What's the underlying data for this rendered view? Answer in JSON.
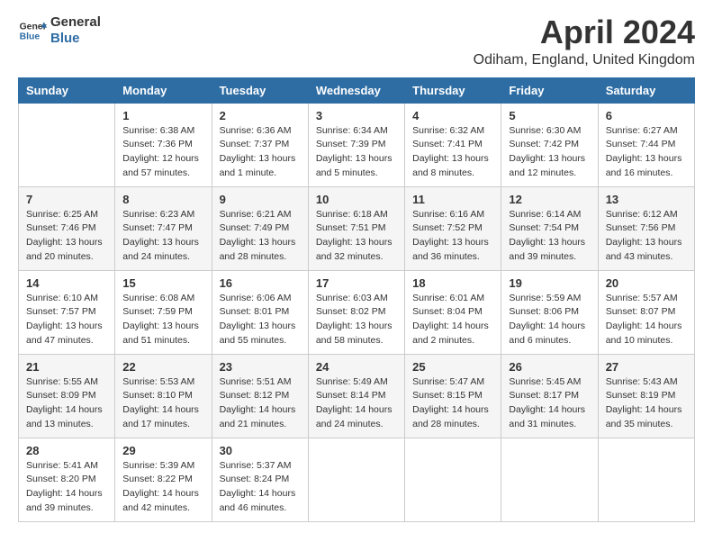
{
  "logo": {
    "general": "General",
    "blue": "Blue"
  },
  "title": "April 2024",
  "subtitle": "Odiham, England, United Kingdom",
  "days_header": [
    "Sunday",
    "Monday",
    "Tuesday",
    "Wednesday",
    "Thursday",
    "Friday",
    "Saturday"
  ],
  "weeks": [
    [
      {
        "num": "",
        "info": ""
      },
      {
        "num": "1",
        "info": "Sunrise: 6:38 AM\nSunset: 7:36 PM\nDaylight: 12 hours\nand 57 minutes."
      },
      {
        "num": "2",
        "info": "Sunrise: 6:36 AM\nSunset: 7:37 PM\nDaylight: 13 hours\nand 1 minute."
      },
      {
        "num": "3",
        "info": "Sunrise: 6:34 AM\nSunset: 7:39 PM\nDaylight: 13 hours\nand 5 minutes."
      },
      {
        "num": "4",
        "info": "Sunrise: 6:32 AM\nSunset: 7:41 PM\nDaylight: 13 hours\nand 8 minutes."
      },
      {
        "num": "5",
        "info": "Sunrise: 6:30 AM\nSunset: 7:42 PM\nDaylight: 13 hours\nand 12 minutes."
      },
      {
        "num": "6",
        "info": "Sunrise: 6:27 AM\nSunset: 7:44 PM\nDaylight: 13 hours\nand 16 minutes."
      }
    ],
    [
      {
        "num": "7",
        "info": "Sunrise: 6:25 AM\nSunset: 7:46 PM\nDaylight: 13 hours\nand 20 minutes."
      },
      {
        "num": "8",
        "info": "Sunrise: 6:23 AM\nSunset: 7:47 PM\nDaylight: 13 hours\nand 24 minutes."
      },
      {
        "num": "9",
        "info": "Sunrise: 6:21 AM\nSunset: 7:49 PM\nDaylight: 13 hours\nand 28 minutes."
      },
      {
        "num": "10",
        "info": "Sunrise: 6:18 AM\nSunset: 7:51 PM\nDaylight: 13 hours\nand 32 minutes."
      },
      {
        "num": "11",
        "info": "Sunrise: 6:16 AM\nSunset: 7:52 PM\nDaylight: 13 hours\nand 36 minutes."
      },
      {
        "num": "12",
        "info": "Sunrise: 6:14 AM\nSunset: 7:54 PM\nDaylight: 13 hours\nand 39 minutes."
      },
      {
        "num": "13",
        "info": "Sunrise: 6:12 AM\nSunset: 7:56 PM\nDaylight: 13 hours\nand 43 minutes."
      }
    ],
    [
      {
        "num": "14",
        "info": "Sunrise: 6:10 AM\nSunset: 7:57 PM\nDaylight: 13 hours\nand 47 minutes."
      },
      {
        "num": "15",
        "info": "Sunrise: 6:08 AM\nSunset: 7:59 PM\nDaylight: 13 hours\nand 51 minutes."
      },
      {
        "num": "16",
        "info": "Sunrise: 6:06 AM\nSunset: 8:01 PM\nDaylight: 13 hours\nand 55 minutes."
      },
      {
        "num": "17",
        "info": "Sunrise: 6:03 AM\nSunset: 8:02 PM\nDaylight: 13 hours\nand 58 minutes."
      },
      {
        "num": "18",
        "info": "Sunrise: 6:01 AM\nSunset: 8:04 PM\nDaylight: 14 hours\nand 2 minutes."
      },
      {
        "num": "19",
        "info": "Sunrise: 5:59 AM\nSunset: 8:06 PM\nDaylight: 14 hours\nand 6 minutes."
      },
      {
        "num": "20",
        "info": "Sunrise: 5:57 AM\nSunset: 8:07 PM\nDaylight: 14 hours\nand 10 minutes."
      }
    ],
    [
      {
        "num": "21",
        "info": "Sunrise: 5:55 AM\nSunset: 8:09 PM\nDaylight: 14 hours\nand 13 minutes."
      },
      {
        "num": "22",
        "info": "Sunrise: 5:53 AM\nSunset: 8:10 PM\nDaylight: 14 hours\nand 17 minutes."
      },
      {
        "num": "23",
        "info": "Sunrise: 5:51 AM\nSunset: 8:12 PM\nDaylight: 14 hours\nand 21 minutes."
      },
      {
        "num": "24",
        "info": "Sunrise: 5:49 AM\nSunset: 8:14 PM\nDaylight: 14 hours\nand 24 minutes."
      },
      {
        "num": "25",
        "info": "Sunrise: 5:47 AM\nSunset: 8:15 PM\nDaylight: 14 hours\nand 28 minutes."
      },
      {
        "num": "26",
        "info": "Sunrise: 5:45 AM\nSunset: 8:17 PM\nDaylight: 14 hours\nand 31 minutes."
      },
      {
        "num": "27",
        "info": "Sunrise: 5:43 AM\nSunset: 8:19 PM\nDaylight: 14 hours\nand 35 minutes."
      }
    ],
    [
      {
        "num": "28",
        "info": "Sunrise: 5:41 AM\nSunset: 8:20 PM\nDaylight: 14 hours\nand 39 minutes."
      },
      {
        "num": "29",
        "info": "Sunrise: 5:39 AM\nSunset: 8:22 PM\nDaylight: 14 hours\nand 42 minutes."
      },
      {
        "num": "30",
        "info": "Sunrise: 5:37 AM\nSunset: 8:24 PM\nDaylight: 14 hours\nand 46 minutes."
      },
      {
        "num": "",
        "info": ""
      },
      {
        "num": "",
        "info": ""
      },
      {
        "num": "",
        "info": ""
      },
      {
        "num": "",
        "info": ""
      }
    ]
  ]
}
